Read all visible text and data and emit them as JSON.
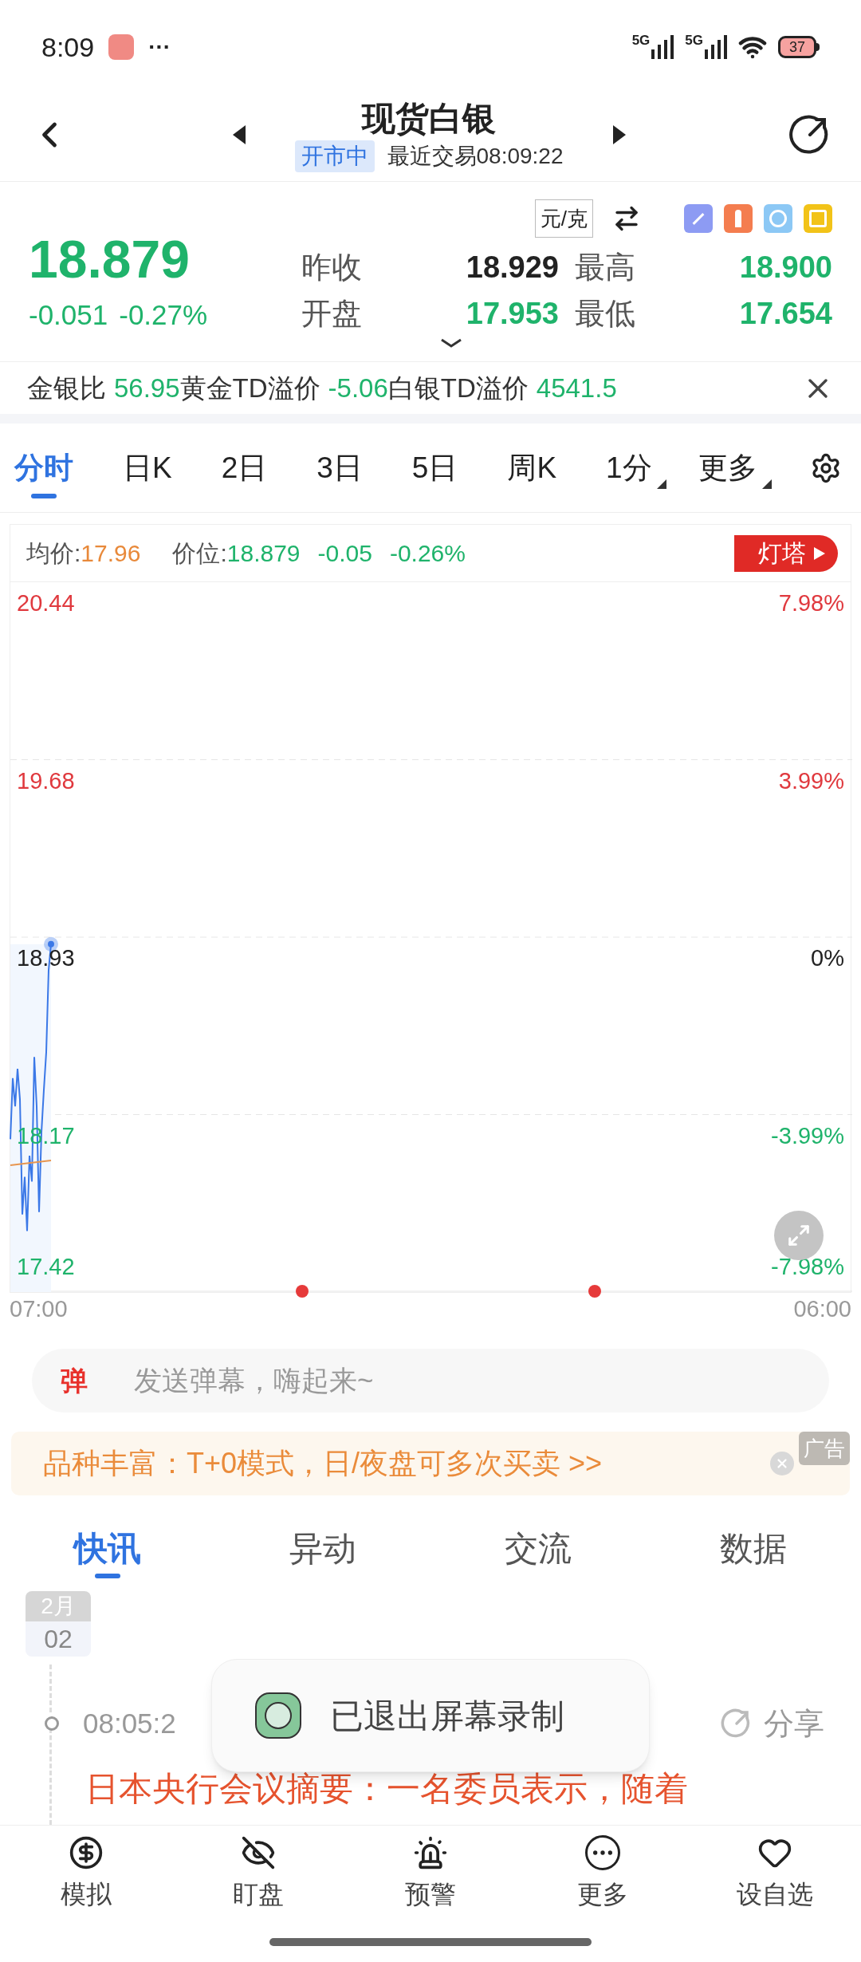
{
  "status_bar": {
    "time": "8:09",
    "more": "···",
    "networks": [
      "5G",
      "5G"
    ],
    "battery": "37"
  },
  "header": {
    "title": "现货白银",
    "market_status": "开市中",
    "last_trade": "最近交易08:09:22"
  },
  "quote": {
    "price": "18.879",
    "change": "-0.051",
    "change_pct": "-0.27%",
    "unit": "元/克",
    "stats": [
      {
        "label": "昨收",
        "value": "18.929",
        "color": "#222222"
      },
      {
        "label": "最高",
        "value": "18.900",
        "color": "#1fb36b"
      },
      {
        "label": "开盘",
        "value": "17.953",
        "color": "#1fb36b"
      },
      {
        "label": "最低",
        "value": "17.654",
        "color": "#1fb36b"
      }
    ]
  },
  "ratio_bar": [
    {
      "label": "金银比",
      "value": "56.95"
    },
    {
      "label": "黄金TD溢价",
      "value": "-5.06"
    },
    {
      "label": "白银TD溢价",
      "value": "4541.5"
    }
  ],
  "period_tabs": [
    {
      "label": "分时",
      "selected": true,
      "dropdown": false
    },
    {
      "label": "日K",
      "selected": false,
      "dropdown": false
    },
    {
      "label": "2日",
      "selected": false,
      "dropdown": false
    },
    {
      "label": "3日",
      "selected": false,
      "dropdown": false
    },
    {
      "label": "5日",
      "selected": false,
      "dropdown": false
    },
    {
      "label": "周K",
      "selected": false,
      "dropdown": false
    },
    {
      "label": "1分",
      "selected": false,
      "dropdown": true
    },
    {
      "label": "更多",
      "selected": false,
      "dropdown": true
    }
  ],
  "chart": {
    "avg_label": "均价:",
    "avg_value": "17.96",
    "price_label": "价位:",
    "price_value": "18.879",
    "price_change": "-0.05",
    "price_change_pct": "-0.26%",
    "promo": "灯塔",
    "axis_rows": [
      {
        "price": "20.44",
        "percent": "7.98%",
        "color": "#e0393e"
      },
      {
        "price": "19.68",
        "percent": "3.99%",
        "color": "#e0393e"
      },
      {
        "price": "18.93",
        "percent": "0%",
        "color": "#222222"
      },
      {
        "price": "18.17",
        "percent": "-3.99%",
        "color": "#1fb36b"
      },
      {
        "price": "17.42",
        "percent": "-7.98%",
        "color": "#1fb36b"
      }
    ],
    "time_labels": [
      "07:00",
      "06:00"
    ]
  },
  "danmaku": {
    "badge": "弹",
    "placeholder": "发送弹幕，嗨起来~"
  },
  "ad": {
    "text": "品种丰富：T+0模式，日/夜盘可多次买卖 >>",
    "tag": "广告"
  },
  "news_tabs": [
    {
      "label": "快讯",
      "selected": true
    },
    {
      "label": "异动",
      "selected": false
    },
    {
      "label": "交流",
      "selected": false
    },
    {
      "label": "数据",
      "selected": false
    }
  ],
  "news": {
    "month": "2月",
    "day": "02",
    "time": "08:05:2",
    "share": "分享",
    "headline": "日本央行会议摘要：一名委员表示，随着"
  },
  "toast": {
    "text": "已退出屏幕录制"
  },
  "bottom_nav": [
    {
      "label": "模拟",
      "kind": "simulate"
    },
    {
      "label": "盯盘",
      "kind": "watch"
    },
    {
      "label": "预警",
      "kind": "alert"
    },
    {
      "label": "更多",
      "kind": "more"
    },
    {
      "label": "设自选",
      "kind": "favorite"
    }
  ]
}
